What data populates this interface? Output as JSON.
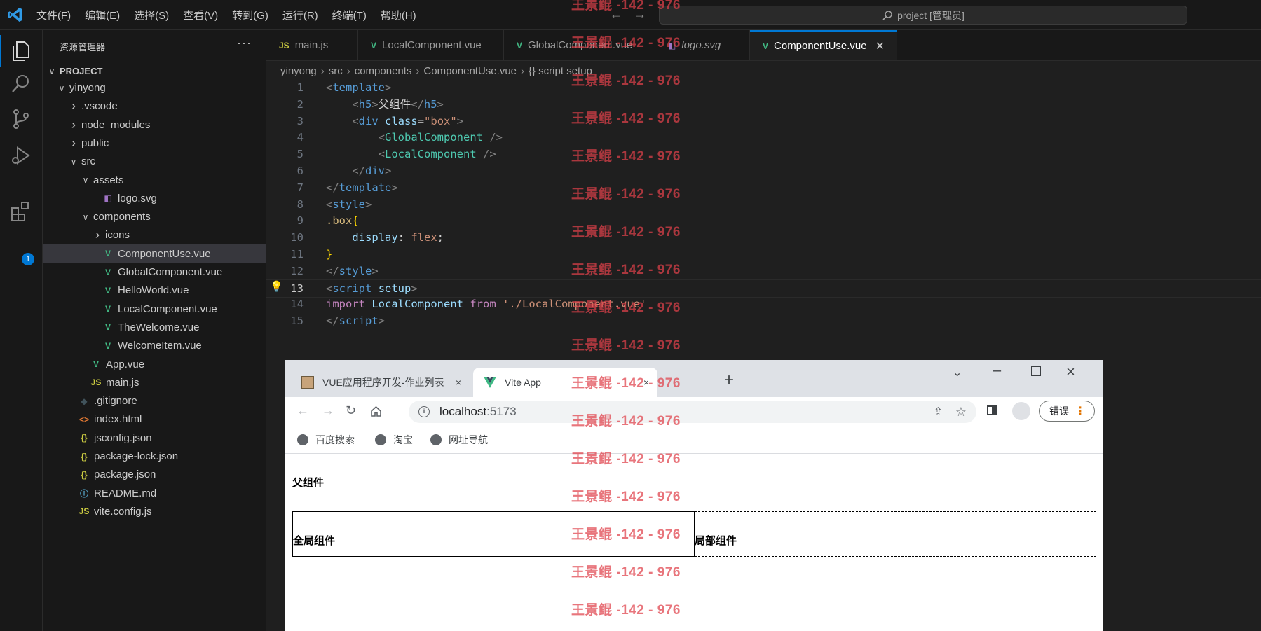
{
  "menu": [
    "文件(F)",
    "编辑(E)",
    "选择(S)",
    "查看(V)",
    "转到(G)",
    "运行(R)",
    "终端(T)",
    "帮助(H)"
  ],
  "command_center": "project [管理员]",
  "activity": {
    "extensions_badge": "1"
  },
  "sidebar": {
    "title": "资源管理器",
    "more": "···",
    "project": "PROJECT",
    "tree": [
      {
        "label": "yinyong",
        "depth": 1,
        "kind": "folder-open"
      },
      {
        "label": ".vscode",
        "depth": 2,
        "kind": "folder"
      },
      {
        "label": "node_modules",
        "depth": 2,
        "kind": "folder"
      },
      {
        "label": "public",
        "depth": 2,
        "kind": "folder"
      },
      {
        "label": "src",
        "depth": 2,
        "kind": "folder-open"
      },
      {
        "label": "assets",
        "depth": 3,
        "kind": "folder-open"
      },
      {
        "label": "logo.svg",
        "depth": 4,
        "kind": "svg"
      },
      {
        "label": "components",
        "depth": 3,
        "kind": "folder-open"
      },
      {
        "label": "icons",
        "depth": 4,
        "kind": "folder"
      },
      {
        "label": "ComponentUse.vue",
        "depth": 4,
        "kind": "vue",
        "selected": true
      },
      {
        "label": "GlobalComponent.vue",
        "depth": 4,
        "kind": "vue"
      },
      {
        "label": "HelloWorld.vue",
        "depth": 4,
        "kind": "vue"
      },
      {
        "label": "LocalComponent.vue",
        "depth": 4,
        "kind": "vue"
      },
      {
        "label": "TheWelcome.vue",
        "depth": 4,
        "kind": "vue"
      },
      {
        "label": "WelcomeItem.vue",
        "depth": 4,
        "kind": "vue"
      },
      {
        "label": "App.vue",
        "depth": 3,
        "kind": "vue"
      },
      {
        "label": "main.js",
        "depth": 3,
        "kind": "js"
      },
      {
        "label": ".gitignore",
        "depth": 2,
        "kind": "git"
      },
      {
        "label": "index.html",
        "depth": 2,
        "kind": "html"
      },
      {
        "label": "jsconfig.json",
        "depth": 2,
        "kind": "json"
      },
      {
        "label": "package-lock.json",
        "depth": 2,
        "kind": "json"
      },
      {
        "label": "package.json",
        "depth": 2,
        "kind": "json"
      },
      {
        "label": "README.md",
        "depth": 2,
        "kind": "info"
      },
      {
        "label": "vite.config.js",
        "depth": 2,
        "kind": "js"
      }
    ]
  },
  "tabs": [
    {
      "label": "main.js",
      "kind": "js"
    },
    {
      "label": "LocalComponent.vue",
      "kind": "vue"
    },
    {
      "label": "GlobalComponent.vue",
      "kind": "vue"
    },
    {
      "label": "logo.svg",
      "kind": "svg",
      "italic": true
    },
    {
      "label": "ComponentUse.vue",
      "kind": "vue",
      "active": true
    }
  ],
  "breadcrumb": [
    "yinyong",
    "src",
    "components",
    "ComponentUse.vue",
    "{} script setup"
  ],
  "code": {
    "current_line": 13,
    "lines": [
      [
        [
          "t-punc",
          "<"
        ],
        [
          "t-tag",
          "template"
        ],
        [
          "t-punc",
          ">"
        ]
      ],
      [
        [
          "t-txt",
          "    "
        ],
        [
          "t-punc",
          "<"
        ],
        [
          "t-tag",
          "h5"
        ],
        [
          "t-punc",
          ">"
        ],
        [
          "t-txt",
          "父组件"
        ],
        [
          "t-punc",
          "</"
        ],
        [
          "t-tag",
          "h5"
        ],
        [
          "t-punc",
          ">"
        ]
      ],
      [
        [
          "t-txt",
          "    "
        ],
        [
          "t-punc",
          "<"
        ],
        [
          "t-tag",
          "div"
        ],
        [
          "t-txt",
          " "
        ],
        [
          "t-attr",
          "class"
        ],
        [
          "t-txt",
          "="
        ],
        [
          "t-str",
          "\"box\""
        ],
        [
          "t-punc",
          ">"
        ]
      ],
      [
        [
          "t-txt",
          "        "
        ],
        [
          "t-punc",
          "<"
        ],
        [
          "t-comp",
          "GlobalComponent"
        ],
        [
          "t-txt",
          " "
        ],
        [
          "t-punc",
          "/>"
        ]
      ],
      [
        [
          "t-txt",
          "        "
        ],
        [
          "t-punc",
          "<"
        ],
        [
          "t-comp",
          "LocalComponent"
        ],
        [
          "t-txt",
          " "
        ],
        [
          "t-punc",
          "/>"
        ]
      ],
      [
        [
          "t-txt",
          "    "
        ],
        [
          "t-punc",
          "</"
        ],
        [
          "t-tag",
          "div"
        ],
        [
          "t-punc",
          ">"
        ]
      ],
      [
        [
          "t-punc",
          "</"
        ],
        [
          "t-tag",
          "template"
        ],
        [
          "t-punc",
          ">"
        ]
      ],
      [
        [
          "t-punc",
          "<"
        ],
        [
          "t-tag",
          "style"
        ],
        [
          "t-punc",
          ">"
        ]
      ],
      [
        [
          "t-sel",
          ".box"
        ],
        [
          "t-brace",
          "{"
        ]
      ],
      [
        [
          "t-txt",
          "    "
        ],
        [
          "t-attr",
          "display"
        ],
        [
          "t-txt",
          ": "
        ],
        [
          "t-str",
          "flex"
        ],
        [
          "t-txt",
          ";"
        ]
      ],
      [
        [
          "t-brace",
          "}"
        ]
      ],
      [
        [
          "t-punc",
          "</"
        ],
        [
          "t-tag",
          "style"
        ],
        [
          "t-punc",
          ">"
        ]
      ],
      [
        [
          "t-punc",
          "<"
        ],
        [
          "t-tag",
          "script"
        ],
        [
          "t-txt",
          " "
        ],
        [
          "t-attr",
          "setup"
        ],
        [
          "t-punc",
          ">"
        ]
      ],
      [
        [
          "t-kw",
          "import"
        ],
        [
          "t-txt",
          " "
        ],
        [
          "t-ident",
          "LocalComponent"
        ],
        [
          "t-txt",
          " "
        ],
        [
          "t-kw",
          "from"
        ],
        [
          "t-txt",
          " "
        ],
        [
          "t-str",
          "'./LocalComponent.vue'"
        ]
      ],
      [
        [
          "t-punc",
          "</"
        ],
        [
          "t-tag",
          "script"
        ],
        [
          "t-punc",
          ">"
        ]
      ]
    ]
  },
  "browser": {
    "tabs": [
      {
        "label": "VUE应用程序开发-作业列表",
        "close": "×"
      },
      {
        "label": "Vite App",
        "close": "×",
        "active": true
      }
    ],
    "new_tab": "+",
    "url_host": "localhost",
    "url_port": ":5173",
    "error_button": "错误",
    "bookmarks": [
      "百度搜索",
      "淘宝",
      "网址导航"
    ],
    "page": {
      "heading": "父组件",
      "global_component": "全局组件",
      "local_component": "局部组件"
    }
  },
  "watermark": "王景鲲 -142 - 976"
}
